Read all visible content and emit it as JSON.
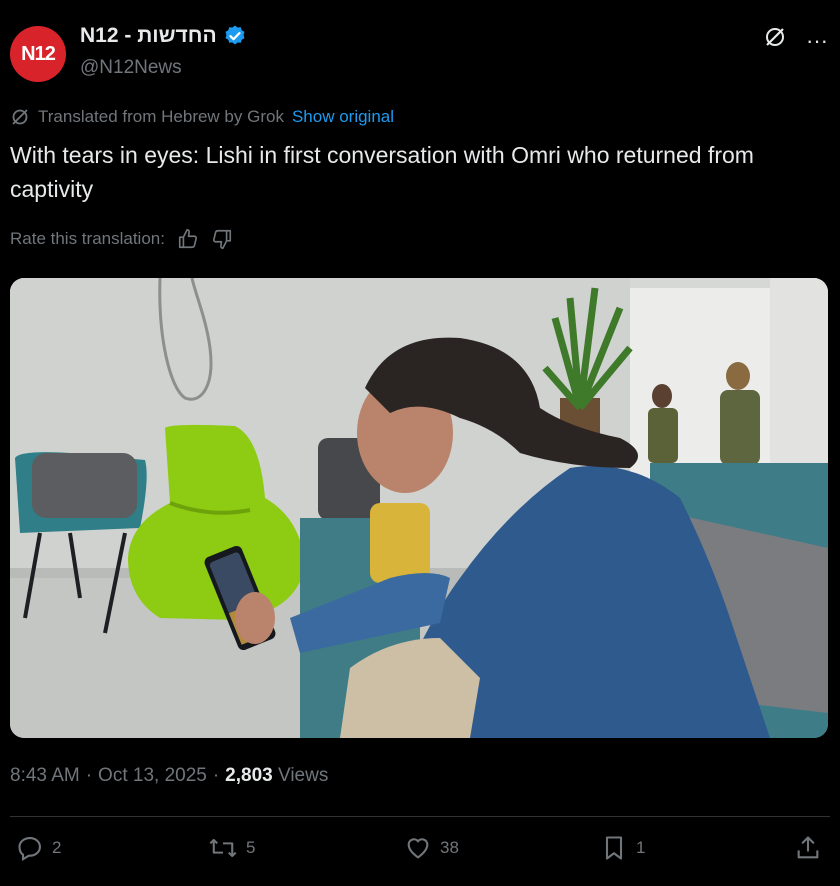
{
  "author": {
    "avatar_text": "N12",
    "display_name": "החדשות - N12",
    "handle": "@N12News"
  },
  "translation": {
    "note": "Translated from Hebrew by Grok",
    "show_original": "Show original"
  },
  "tweet": {
    "text": "With tears in eyes: Lishi in first conversation with Omri who returned from captivity"
  },
  "rate": {
    "label": "Rate this translation:"
  },
  "meta": {
    "time": "8:43 AM",
    "date": "Oct 13, 2025",
    "views_count": "2,803",
    "views_label": "Views"
  },
  "actions": {
    "replies": "2",
    "reposts": "5",
    "likes": "38",
    "bookmarks": "1"
  },
  "colors": {
    "background": "#000000",
    "text": "#e7e9ea",
    "muted": "#71767b",
    "accent": "#1d9bf0",
    "avatar_red": "#d9232a"
  }
}
